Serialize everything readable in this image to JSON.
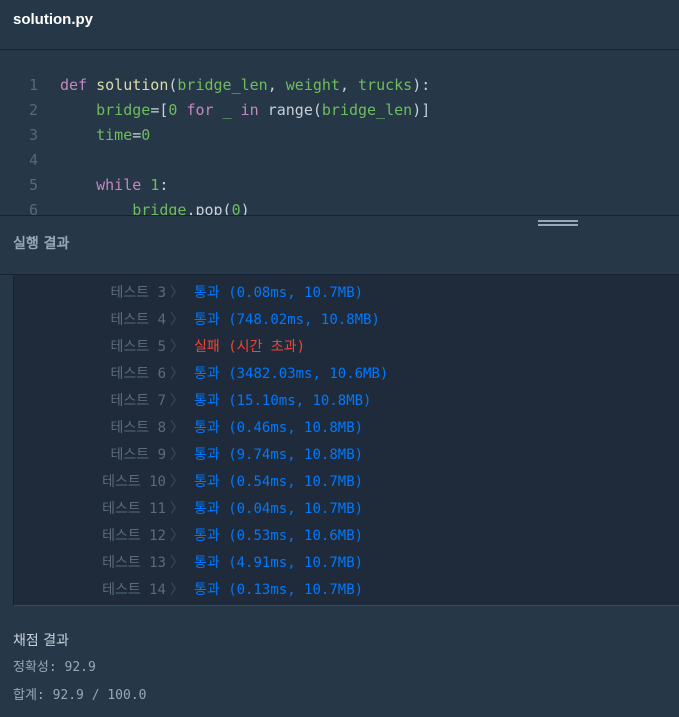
{
  "file": {
    "title": "solution.py"
  },
  "editor": {
    "lines": [
      {
        "n": "1",
        "parts": [
          [
            "kw",
            "def "
          ],
          [
            "fn",
            "solution"
          ],
          [
            "op",
            "("
          ],
          [
            "param",
            "bridge_len"
          ],
          [
            "op",
            ", "
          ],
          [
            "param",
            "weight"
          ],
          [
            "op",
            ", "
          ],
          [
            "param",
            "trucks"
          ],
          [
            "op",
            "):"
          ]
        ]
      },
      {
        "n": "2",
        "parts": [
          [
            "op",
            "    "
          ],
          [
            "param",
            "bridge"
          ],
          [
            "op",
            "=["
          ],
          [
            "num",
            "0"
          ],
          [
            "op",
            " "
          ],
          [
            "kw",
            "for"
          ],
          [
            "op",
            " "
          ],
          [
            "param",
            "_"
          ],
          [
            "op",
            " "
          ],
          [
            "kw",
            "in"
          ],
          [
            "op",
            " range("
          ],
          [
            "param",
            "bridge_len"
          ],
          [
            "op",
            ")]"
          ]
        ]
      },
      {
        "n": "3",
        "parts": [
          [
            "op",
            "    "
          ],
          [
            "param",
            "time"
          ],
          [
            "op",
            "="
          ],
          [
            "num",
            "0"
          ]
        ]
      },
      {
        "n": "4",
        "parts": []
      },
      {
        "n": "5",
        "parts": [
          [
            "op",
            "    "
          ],
          [
            "kw",
            "while"
          ],
          [
            "op",
            " "
          ],
          [
            "num",
            "1"
          ],
          [
            "op",
            ":"
          ]
        ]
      },
      {
        "n": "6",
        "parts": [
          [
            "op",
            "        "
          ],
          [
            "param",
            "bridge"
          ],
          [
            "op",
            ".pop("
          ],
          [
            "num",
            "0"
          ],
          [
            "op",
            ")"
          ]
        ]
      }
    ]
  },
  "results": {
    "title": "실행 결과",
    "tests": [
      {
        "label": "테스트 3",
        "status": "pass",
        "result": "통과 (0.08ms, 10.7MB)"
      },
      {
        "label": "테스트 4",
        "status": "pass",
        "result": "통과 (748.02ms, 10.8MB)"
      },
      {
        "label": "테스트 5",
        "status": "fail",
        "result": "실패 (시간 초과)"
      },
      {
        "label": "테스트 6",
        "status": "pass",
        "result": "통과 (3482.03ms, 10.6MB)"
      },
      {
        "label": "테스트 7",
        "status": "pass",
        "result": "통과 (15.10ms, 10.8MB)"
      },
      {
        "label": "테스트 8",
        "status": "pass",
        "result": "통과 (0.46ms, 10.8MB)"
      },
      {
        "label": "테스트 9",
        "status": "pass",
        "result": "통과 (9.74ms, 10.8MB)"
      },
      {
        "label": "테스트 10",
        "status": "pass",
        "result": "통과 (0.54ms, 10.7MB)"
      },
      {
        "label": "테스트 11",
        "status": "pass",
        "result": "통과 (0.04ms, 10.7MB)"
      },
      {
        "label": "테스트 12",
        "status": "pass",
        "result": "통과 (0.53ms, 10.6MB)"
      },
      {
        "label": "테스트 13",
        "status": "pass",
        "result": "통과 (4.91ms, 10.7MB)"
      },
      {
        "label": "테스트 14",
        "status": "pass",
        "result": "통과 (0.13ms, 10.7MB)"
      }
    ]
  },
  "grading": {
    "title": "채점 결과",
    "accuracy": "정확성: 92.9",
    "total": "합계: 92.9 / 100.0"
  },
  "icons": {
    "chevron": "chevron-right-icon",
    "drag": "drag-handle-icon"
  },
  "colors": {
    "pass": "#0078ff",
    "fail": "#f44336",
    "background": "#263747"
  }
}
